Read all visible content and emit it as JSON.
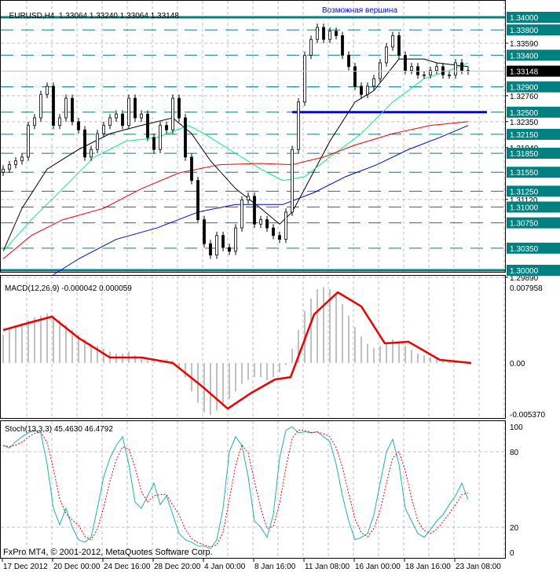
{
  "header": {
    "symbol": "EURUSD,H4",
    "ohlc": "1.33064 1.33240 1.33064 1.33148"
  },
  "annotation": "Возможная вершина",
  "footer": "FxPro MT4, © 2001-2012, MetaQuotes Software Corp.",
  "colors": {
    "level": "#008080",
    "support": "#0000ff",
    "ma_fast": "#000000",
    "ma_green": "#00ee88",
    "ma_red": "#ee0000",
    "ma_blue": "#0000dd",
    "macd_signal": "#ee0000",
    "macd_hist": "#c0c0c0",
    "stoch_main": "#20b2aa",
    "stoch_signal": "#ee0000"
  },
  "chart_data": [
    {
      "type": "line",
      "title": "EURUSD,H4",
      "ylim": [
        1.2975,
        1.3428
      ],
      "x_tick_labels": [
        "17 Dec 2012",
        "20 Dec 00:00",
        "24 Dec 16:00",
        "28 Dec 20:00",
        "4 Jan 00:00",
        "8 Jan 16:00",
        "11 Jan 08:00",
        "16 Jan 00:00",
        "18 Jan 16:00",
        "23 Jan 08:00"
      ],
      "x_tick_index": [
        0,
        8,
        16,
        24,
        32,
        40,
        48,
        56,
        64,
        72
      ],
      "closes": [
        1.316,
        1.3167,
        1.3173,
        1.3179,
        1.3229,
        1.3241,
        1.3278,
        1.3291,
        1.3229,
        1.3241,
        1.3272,
        1.3235,
        1.3222,
        1.3179,
        1.3191,
        1.3216,
        1.3229,
        1.3241,
        1.3247,
        1.3229,
        1.3272,
        1.3241,
        1.3247,
        1.321,
        1.3191,
        1.3229,
        1.3222,
        1.3272,
        1.3241,
        1.3179,
        1.3142,
        1.308,
        1.3042,
        1.3024,
        1.3055,
        1.3036,
        1.303,
        1.3067,
        1.3111,
        1.3117,
        1.3073,
        1.308,
        1.3067,
        1.3055,
        1.3049,
        1.3092,
        1.3191,
        1.3266,
        1.334,
        1.3365,
        1.3384,
        1.3365,
        1.3378,
        1.3371,
        1.334,
        1.3322,
        1.3291,
        1.3278,
        1.3291,
        1.3303,
        1.3328,
        1.3353,
        1.3371,
        1.334,
        1.3316,
        1.3322,
        1.3309,
        1.3309,
        1.3316,
        1.3322,
        1.3309,
        1.3309,
        1.3328,
        1.3316,
        1.3315
      ],
      "moving_averages": [
        {
          "name": "ma_fast",
          "points": [
            [
              0,
              1.303
            ],
            [
              3,
              1.3098
            ],
            [
              7,
              1.316
            ],
            [
              12,
              1.3191
            ],
            [
              17,
              1.3216
            ],
            [
              22,
              1.3229
            ],
            [
              27,
              1.3241
            ],
            [
              30,
              1.3216
            ],
            [
              33,
              1.3173
            ],
            [
              37,
              1.3129
            ],
            [
              41,
              1.3098
            ],
            [
              44,
              1.3073
            ],
            [
              46,
              1.3092
            ],
            [
              48,
              1.3129
            ],
            [
              52,
              1.3204
            ],
            [
              56,
              1.3266
            ],
            [
              59,
              1.3284
            ],
            [
              63,
              1.3334
            ],
            [
              67,
              1.3334
            ],
            [
              69,
              1.3328
            ],
            [
              74,
              1.3322
            ]
          ]
        },
        {
          "name": "ma_green",
          "points": [
            [
              0,
              1.303
            ],
            [
              4.5,
              1.308
            ],
            [
              9.5,
              1.3129
            ],
            [
              14.5,
              1.3179
            ],
            [
              19.5,
              1.3204
            ],
            [
              24.5,
              1.321
            ],
            [
              29.5,
              1.3229
            ],
            [
              32,
              1.3216
            ],
            [
              36,
              1.3191
            ],
            [
              41,
              1.316
            ],
            [
              44.5,
              1.3142
            ],
            [
              48,
              1.3148
            ],
            [
              52,
              1.3179
            ],
            [
              57,
              1.3216
            ],
            [
              62,
              1.3266
            ],
            [
              67,
              1.3303
            ],
            [
              71,
              1.3316
            ],
            [
              74,
              1.3328
            ]
          ]
        },
        {
          "name": "ma_red",
          "points": [
            [
              0,
              1.3018
            ],
            [
              4.5,
              1.3055
            ],
            [
              9.5,
              1.308
            ],
            [
              16,
              1.3098
            ],
            [
              22,
              1.3129
            ],
            [
              28,
              1.3154
            ],
            [
              34.5,
              1.3167
            ],
            [
              41,
              1.3169
            ],
            [
              46,
              1.3167
            ],
            [
              51,
              1.3179
            ],
            [
              56,
              1.3198
            ],
            [
              62,
              1.3216
            ],
            [
              68,
              1.3229
            ],
            [
              74,
              1.3235
            ]
          ]
        },
        {
          "name": "ma_blue",
          "points": [
            [
              8,
              1.2993
            ],
            [
              12,
              1.3018
            ],
            [
              18,
              1.3049
            ],
            [
              24.5,
              1.3067
            ],
            [
              31,
              1.3092
            ],
            [
              37,
              1.3104
            ],
            [
              44.5,
              1.3104
            ],
            [
              49.5,
              1.3123
            ],
            [
              54.5,
              1.3148
            ],
            [
              59.5,
              1.3167
            ],
            [
              64.5,
              1.3191
            ],
            [
              69.5,
              1.321
            ],
            [
              74,
              1.3229
            ]
          ]
        }
      ],
      "level_lines": [
        {
          "price": 1.34,
          "label": "1.34000",
          "style": "thick"
        },
        {
          "price": 1.338,
          "label": "1.33800",
          "style": "dashed"
        },
        {
          "price": 1.334,
          "label": "1.33400",
          "style": "dashed"
        },
        {
          "price": 1.329,
          "label": "1.32900",
          "style": "dashed"
        },
        {
          "price": 1.325,
          "label": "1.32500",
          "style": "dashed"
        },
        {
          "price": 1.3215,
          "label": "1.32150",
          "style": "dashed"
        },
        {
          "price": 1.3185,
          "label": "1.31850",
          "style": "dashed"
        },
        {
          "price": 1.3155,
          "label": "1.31550",
          "style": "dashed"
        },
        {
          "price": 1.3125,
          "label": "1.31250",
          "style": "dashed"
        },
        {
          "price": 1.31,
          "label": "1.31000",
          "style": "dashed"
        },
        {
          "price": 1.3075,
          "label": "1.30750",
          "style": "dashed"
        },
        {
          "price": 1.3035,
          "label": "1.30350",
          "style": "dashed"
        },
        {
          "price": 1.3,
          "label": "1.30000",
          "style": "thick"
        }
      ],
      "support_line": {
        "price": 1.325,
        "from_index": 46,
        "to_index": 77
      },
      "grid_prices": [
        "1.33590",
        "1.32760",
        "1.32350",
        "1.31940",
        "1.31120",
        "1.29890"
      ],
      "current_price": "1.33148"
    },
    {
      "type": "bar",
      "title": "MACD(12,26,9) -0.000042 0.000059",
      "ylim": [
        -0.00537,
        0.007958
      ],
      "y_tick_labels": [
        "0.007958",
        "0.00",
        "-0.005370"
      ],
      "histogram": [
        0.003,
        0.0035,
        0.004,
        0.0042,
        0.0045,
        0.0048,
        0.005,
        0.0052,
        0.005,
        0.0045,
        0.004,
        0.0035,
        0.003,
        0.0025,
        0.002,
        0.0018,
        0.0015,
        0.0012,
        0.001,
        0.001,
        0.0012,
        0.0008,
        0.0005,
        0.0003,
        0.0002,
        0.0003,
        0.0004,
        0.0002,
        -0.0005,
        -0.0015,
        -0.003,
        -0.0042,
        -0.0052,
        -0.0055,
        -0.005,
        -0.0045,
        -0.0038,
        -0.003,
        -0.0022,
        -0.0018,
        -0.0015,
        -0.0015,
        -0.0018,
        -0.0015,
        -0.001,
        -0.0002,
        0.0015,
        0.0035,
        0.0055,
        0.0068,
        0.0078,
        0.008,
        0.0078,
        0.0072,
        0.0062,
        0.005,
        0.0038,
        0.0028,
        0.002,
        0.0016,
        0.0018,
        0.0022,
        0.0025,
        0.0022,
        0.0018,
        0.0014,
        0.001,
        0.0008,
        0.0006,
        0.0005,
        0.0004,
        0.0003,
        0.0002,
        0.0002,
        0.0001
      ],
      "signal": [
        [
          0,
          0.00348
        ],
        [
          4.5,
          0.00431
        ],
        [
          7.75,
          0.00489
        ],
        [
          12,
          0.00265
        ],
        [
          17,
          0.00058
        ],
        [
          22,
          0.00058
        ],
        [
          27,
          0
        ],
        [
          31.4,
          -0.00232
        ],
        [
          35.75,
          -0.00481
        ],
        [
          39.5,
          -0.00315
        ],
        [
          43.25,
          -0.00174
        ],
        [
          45.75,
          -0.00149
        ],
        [
          49.5,
          0.00514
        ],
        [
          53.25,
          0.00746
        ],
        [
          57,
          0.00597
        ],
        [
          60.75,
          0.00207
        ],
        [
          64.5,
          0.00224
        ],
        [
          69.5,
          0.00033
        ],
        [
          74.5,
          0
        ]
      ]
    },
    {
      "type": "line",
      "title": "Stoch(13,3,3) 45.4630 46.4792",
      "ylim": [
        0,
        100
      ],
      "y_tick_labels": [
        "100",
        "80",
        "20",
        "0"
      ],
      "main": [
        85,
        83,
        88,
        92,
        95,
        97,
        95,
        70,
        35,
        22,
        35,
        20,
        10,
        8,
        12,
        35,
        60,
        75,
        85,
        92,
        70,
        40,
        35,
        45,
        55,
        38,
        45,
        30,
        15,
        10,
        8,
        5,
        5,
        3,
        10,
        35,
        80,
        92,
        85,
        60,
        25,
        20,
        12,
        30,
        75,
        97,
        100,
        95,
        96,
        95,
        96,
        92,
        88,
        70,
        45,
        25,
        10,
        12,
        15,
        30,
        55,
        80,
        90,
        70,
        35,
        25,
        15,
        12,
        18,
        25,
        30,
        38,
        45,
        55,
        42
      ]
    }
  ]
}
